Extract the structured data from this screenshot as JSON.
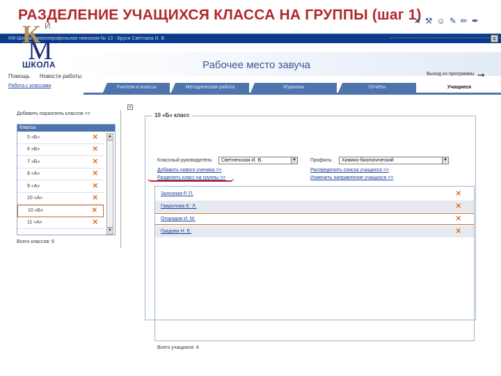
{
  "slide_title": "РАЗДЕЛЕНИЕ УЧАЩИХСЯ КЛАССА НА ГРУППЫ (шаг 1)",
  "window": {
    "title": "КМ-Школа - многопрофильная гимназия № 13 - Бруся Светлана И. В.",
    "close_label": "x"
  },
  "toolbar": {
    "icons": [
      "close-icon",
      "tools-icon",
      "user-icon",
      "edit-icon",
      "pencil-icon",
      "pen-icon"
    ]
  },
  "logo": {
    "k": "К",
    "i": "И",
    "m": "М",
    "shkola": "ШКОЛА"
  },
  "page_heading": "Рабочее место завуча",
  "menu": {
    "items": [
      "Помощь",
      "Новости работы"
    ]
  },
  "right_link": "Выход из программы",
  "tabs": {
    "left_link": "Работа с классами",
    "items": [
      {
        "label": "Учителя и классы"
      },
      {
        "label": "Методическая работа"
      },
      {
        "label": "Журналы"
      },
      {
        "label": "Отчёты"
      },
      {
        "label": "Учащиеся"
      }
    ]
  },
  "left_panel": {
    "add_link": "Добавить параллель классов >>",
    "list_header": "Классы",
    "classes": [
      {
        "name": "5 «Б»"
      },
      {
        "name": "6 «Б»"
      },
      {
        "name": "7 «Б»"
      },
      {
        "name": "8 «А»"
      },
      {
        "name": "9 «А»"
      },
      {
        "name": "10 «А»"
      },
      {
        "name": "10 «Б»",
        "selected": true
      },
      {
        "name": "11 «А»"
      }
    ],
    "total": "Всего классов: 9"
  },
  "group": {
    "legend": "10 «Б» класс",
    "teacher_label": "Классный руководитель:",
    "teacher_value": "Светленская И. В.",
    "profile_label": "Профиль:",
    "profile_value": "Химико-биологический",
    "link_add_student": "Добавить нового ученика >>",
    "link_split": "Разделить класс на группы >>",
    "link_distribute": "Распределить список учащихся >>",
    "link_transfer": "Изменить направление учащихся >>",
    "students": [
      {
        "name": "Залозная Р. П."
      },
      {
        "name": "Гаврилова Е. Л."
      },
      {
        "name": "Огородов И. М.",
        "selected": true
      },
      {
        "name": "Градова Н. Е."
      }
    ],
    "total": "Всего учащихся: 4"
  },
  "colors": {
    "title_red": "#b0282c",
    "tab_blue": "#4e74ad",
    "delete_orange": "#e46b1c",
    "link_blue": "#1a3f9a"
  }
}
